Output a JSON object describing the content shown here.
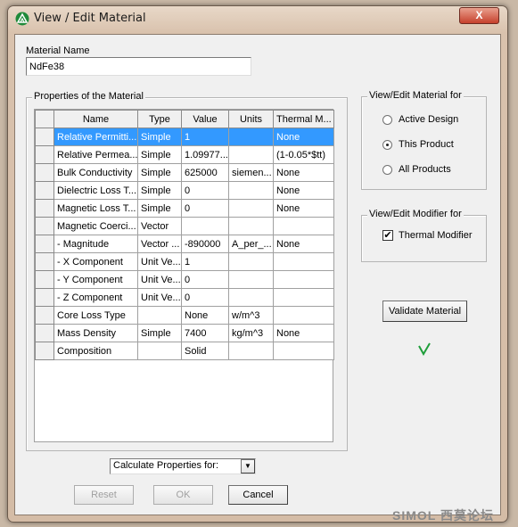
{
  "window": {
    "title": "View / Edit Material",
    "close_label": "X"
  },
  "material_name": {
    "label": "Material Name",
    "value": "NdFe38"
  },
  "properties": {
    "group_label": "Properties of the Material",
    "columns": [
      "Name",
      "Type",
      "Value",
      "Units",
      "Thermal M..."
    ],
    "rows": [
      [
        "Relative Permitti...",
        "Simple",
        "1",
        "",
        "None"
      ],
      [
        "Relative Permea...",
        "Simple",
        "1.09977...",
        "",
        "(1-0.05*$tt)"
      ],
      [
        "Bulk Conductivity",
        "Simple",
        "625000",
        "siemen...",
        "None"
      ],
      [
        "Dielectric Loss T...",
        "Simple",
        "0",
        "",
        "None"
      ],
      [
        "Magnetic Loss T...",
        "Simple",
        "0",
        "",
        "None"
      ],
      [
        "Magnetic Coerci...",
        "Vector",
        "",
        "",
        ""
      ],
      [
        "-  Magnitude",
        "Vector ...",
        "-890000",
        "A_per_...",
        "None"
      ],
      [
        "-  X Component",
        "Unit Ve...",
        "1",
        "",
        ""
      ],
      [
        "-  Y Component",
        "Unit Ve...",
        "0",
        "",
        ""
      ],
      [
        "-  Z Component",
        "Unit Ve...",
        "0",
        "",
        ""
      ],
      [
        "Core Loss Type",
        "",
        "None",
        "w/m^3",
        ""
      ],
      [
        "Mass Density",
        "Simple",
        "7400",
        "kg/m^3",
        "None"
      ],
      [
        "Composition",
        "",
        "Solid",
        "",
        ""
      ]
    ],
    "selected_row": 0
  },
  "material_for": {
    "label": "View/Edit Material for",
    "options": [
      "Active Design",
      "This Product",
      "All Products"
    ],
    "selected": "This Product"
  },
  "modifier_for": {
    "label": "View/Edit Modifier for",
    "checkbox_label": "Thermal Modifier",
    "checked": true
  },
  "validate_label": "Validate Material",
  "validation_status": "valid",
  "calc_dropdown": {
    "value": "Calculate Properties for:"
  },
  "buttons": {
    "reset": "Reset",
    "ok": "OK",
    "cancel": "Cancel"
  },
  "watermark": "SIMOL 西莫论坛",
  "colors": {
    "selection": "#3399ff",
    "check": "#1e9e3a"
  }
}
